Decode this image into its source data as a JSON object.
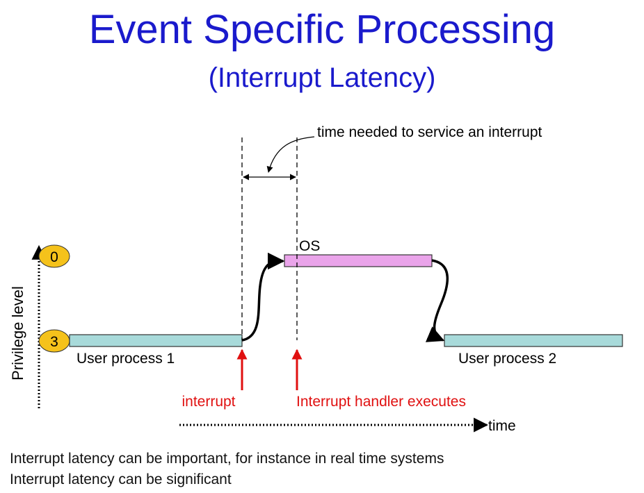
{
  "slide": {
    "title": "Event Specific Processing",
    "subtitle": "(Interrupt Latency)"
  },
  "diagram": {
    "annotation": "time needed to service an interrupt",
    "y_axis_label": "Privilege level",
    "levels": [
      "0",
      "3"
    ],
    "os_label": "OS",
    "process_1_label": "User process 1",
    "process_2_label": "User process 2",
    "interrupt_label": "interrupt",
    "handler_label": "Interrupt handler executes",
    "time_label": "time",
    "colors": {
      "title": "#1a1acc",
      "user_bar": "#a8dada",
      "os_bar": "#eaa4ea",
      "level_badge": "#f5c21b",
      "marker": "#e01010"
    }
  },
  "notes": [
    "Interrupt latency can be important, for instance in real time systems",
    "Interrupt latency can be significant"
  ]
}
